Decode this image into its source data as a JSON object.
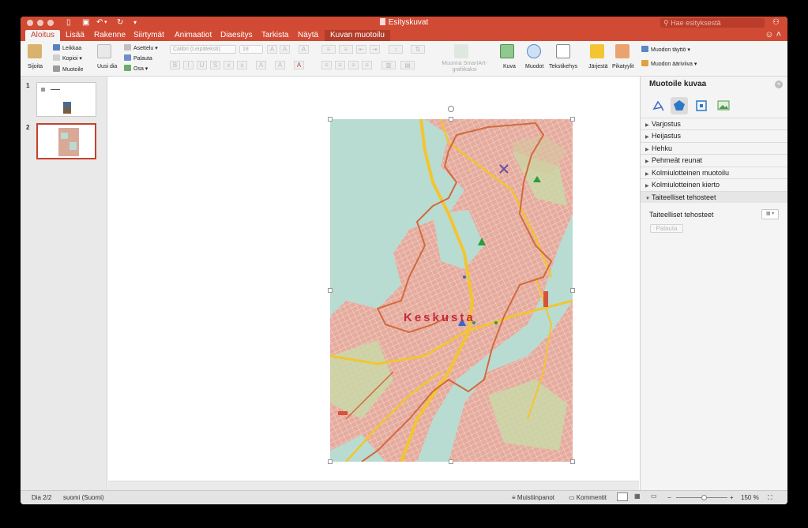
{
  "window": {
    "title": "Esityskuvat"
  },
  "search": {
    "placeholder": "Hae esityksestä"
  },
  "tabs": [
    {
      "label": "Aloitus",
      "active": true
    },
    {
      "label": "Lisää"
    },
    {
      "label": "Rakenne"
    },
    {
      "label": "Siirtymät"
    },
    {
      "label": "Animaatiot"
    },
    {
      "label": "Diaesitys"
    },
    {
      "label": "Tarkista"
    },
    {
      "label": "Näytä"
    },
    {
      "label": "Kuvan muotoilu",
      "contextual": true
    }
  ],
  "ribbon": {
    "paste": "Sijoita",
    "cut": "Leikkaa",
    "copy": "Kopioi",
    "format": "Muotoile",
    "new_slide": "Uusi dia",
    "layout": "Asettelu",
    "reset": "Palauta",
    "section": "Osa",
    "font_name": "Calibri (Leipäteksti)",
    "font_size": "18",
    "convert_smartart": "Muunna SmartArt-grafiikaksi",
    "picture": "Kuva",
    "shapes": "Muodot",
    "textbox": "Tekstikehys",
    "arrange": "Järjestä",
    "quick_styles": "Pikatyylit",
    "shape_fill": "Muodon täyttö",
    "shape_outline": "Muodon ääriviiva"
  },
  "slides": [
    {
      "number": "1"
    },
    {
      "number": "2",
      "selected": true
    }
  ],
  "map": {
    "label": "Keskusta"
  },
  "pane": {
    "title": "Muotoile kuvaa",
    "sections": [
      {
        "label": "Varjostus"
      },
      {
        "label": "Heijastus"
      },
      {
        "label": "Hehku"
      },
      {
        "label": "Pehmeät reunat"
      },
      {
        "label": "Kolmiulotteinen muotoilu"
      },
      {
        "label": "Kolmiulotteinen kierto"
      },
      {
        "label": "Taiteelliset tehosteet",
        "open": true
      }
    ],
    "artistic_label": "Taiteelliset tehosteet",
    "reset_button": "Palauta"
  },
  "status": {
    "slide": "Dia 2/2",
    "language": "suomi (Suomi)",
    "notes": "Muistiinpanot",
    "comments": "Kommentit",
    "zoom": "150 %"
  },
  "colors": {
    "accent": "#d04a34",
    "ribbon_bg": "#f4f4f4",
    "map_water": "#b9dcd2",
    "map_urban": "#e3a89c",
    "map_road_major": "#f2c531",
    "map_boundary": "#d26a3d"
  }
}
